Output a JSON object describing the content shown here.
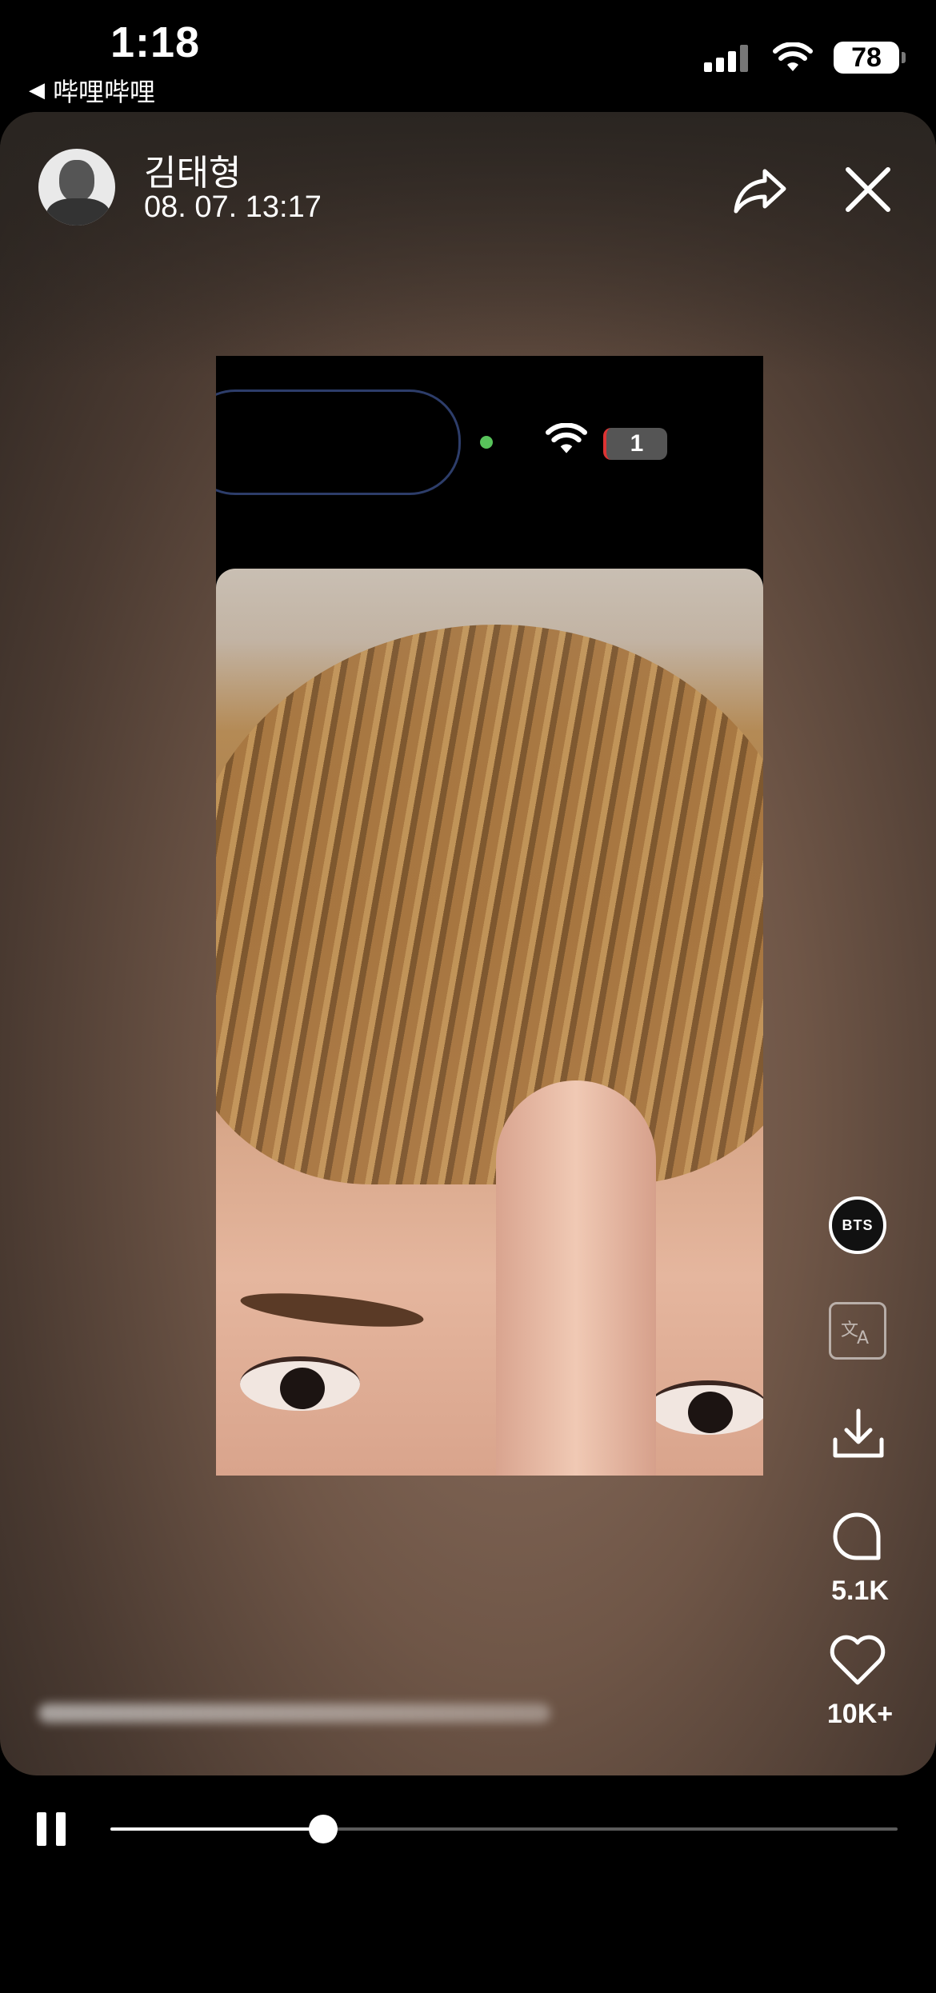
{
  "status_bar": {
    "time": "1:18",
    "back_app": "哔哩哔哩",
    "battery": "78"
  },
  "post": {
    "username": "김태형",
    "timestamp": "08. 07. 13:17"
  },
  "media": {
    "battery_overlay": "1"
  },
  "actions": {
    "badge": "BTS",
    "comment_count": "5.1K",
    "like_count": "10K+"
  },
  "player": {
    "progress": 0.27
  },
  "icons": [
    "back-arrow-icon",
    "cellular-icon",
    "wifi-icon",
    "battery-icon",
    "share-icon",
    "close-icon",
    "translate-icon",
    "download-icon",
    "comment-icon",
    "heart-icon",
    "pause-icon"
  ]
}
